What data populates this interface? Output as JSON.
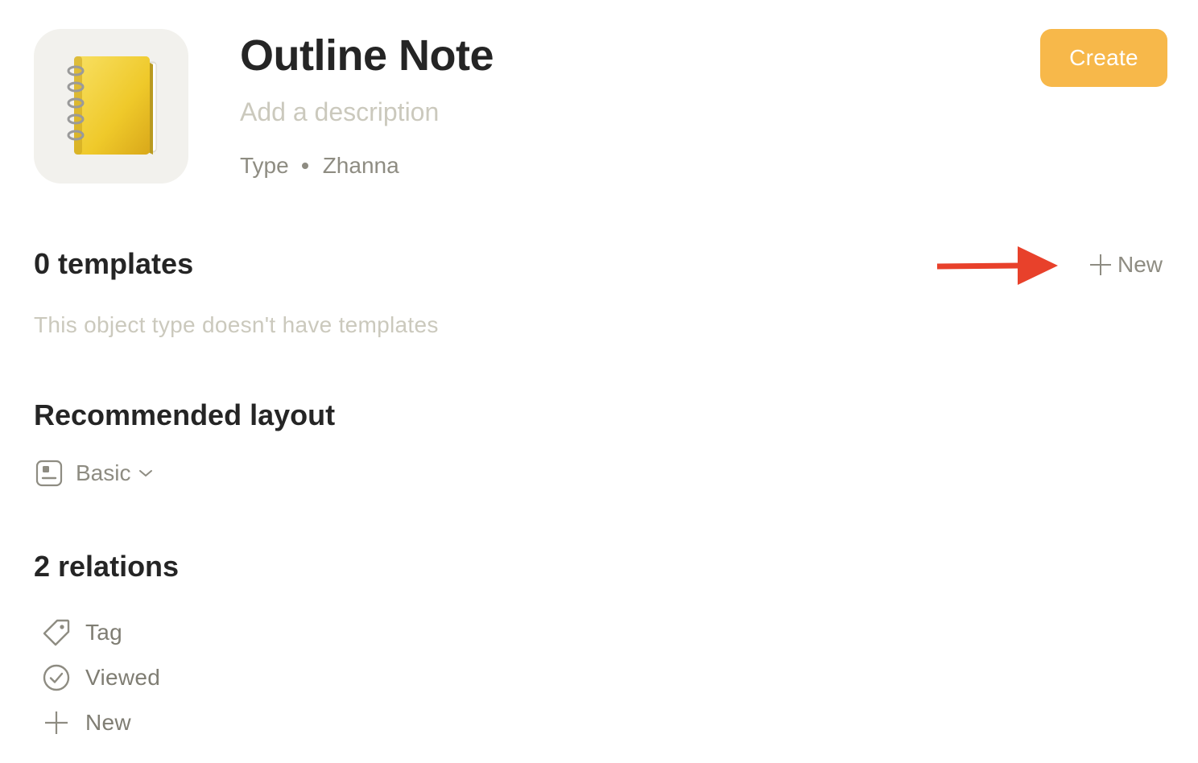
{
  "header": {
    "icon": "notebook-emoji-icon",
    "title": "Outline Note",
    "description_placeholder": "Add a description",
    "meta_type": "Type",
    "meta_author": "Zhanna",
    "create_label": "Create"
  },
  "templates": {
    "heading": "0 templates",
    "new_label": "New",
    "empty_text": "This object type doesn't have templates"
  },
  "layout": {
    "heading": "Recommended layout",
    "selected": "Basic",
    "icon": "layout-basic-icon"
  },
  "relations": {
    "heading": "2 relations",
    "items": [
      {
        "label": "Tag",
        "icon": "tag-icon"
      },
      {
        "label": "Viewed",
        "icon": "check-circle-icon"
      }
    ],
    "new_label": "New"
  },
  "colors": {
    "accent": "#f7b84a",
    "annotation_arrow": "#e8412b",
    "muted_text": "#8e8c82",
    "placeholder_text": "#cbc9bd"
  }
}
